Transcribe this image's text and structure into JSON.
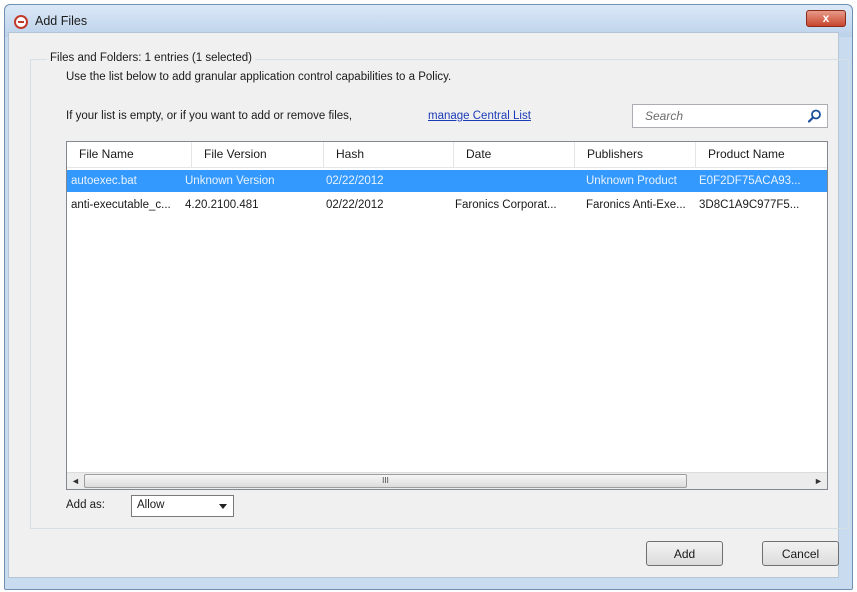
{
  "window": {
    "title": "Add Files",
    "close_label": "x"
  },
  "group": {
    "label": "Files and Folders: 1 entries (1 selected)",
    "description": "Use the list below to add granular application control capabilities to a Policy.",
    "hint": "If your list is empty, or if you want to add or remove files,",
    "link_label": "manage Central List"
  },
  "search": {
    "placeholder": "Search",
    "value": ""
  },
  "table": {
    "columns": [
      "File Name",
      "File Version",
      "Hash",
      "Date",
      "Publishers",
      "Product Name"
    ],
    "rows": [
      {
        "selected": true,
        "cells": [
          "autoexec.bat",
          "Unknown Version",
          "02/22/2012",
          "",
          "Unknown Product",
          "E0F2DF75ACA93..."
        ]
      },
      {
        "selected": false,
        "cells": [
          "anti-executable_c...",
          "4.20.2100.481",
          "02/22/2012",
          "Faronics Corporat...",
          "Faronics Anti-Exe...",
          "3D8C1A9C977F5..."
        ]
      }
    ],
    "scroll": {
      "left_arrow": "◄",
      "right_arrow": "►",
      "thumb_grip": "III"
    }
  },
  "add_as": {
    "label": "Add as:",
    "selected": "Allow"
  },
  "buttons": {
    "add": "Add",
    "cancel": "Cancel"
  },
  "colors": {
    "selection": "#3399ff",
    "link": "#1a3bb8",
    "title_bar": "#bcd2ea",
    "close_button": "#c7462d"
  }
}
